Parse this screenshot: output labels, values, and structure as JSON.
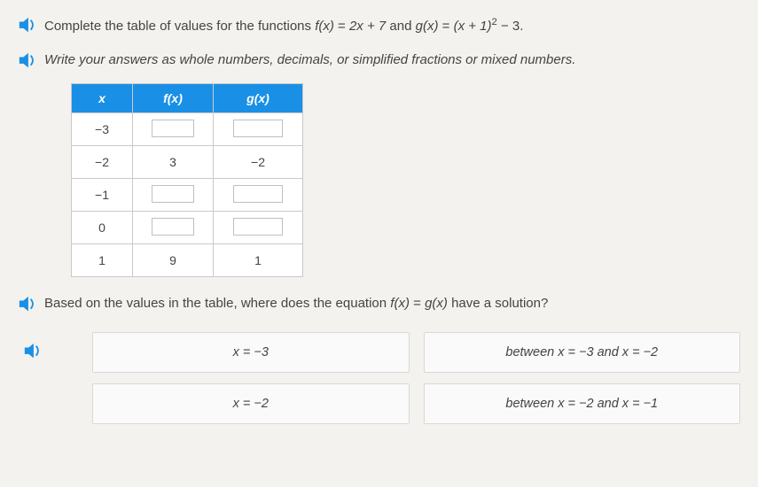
{
  "prompt1_prefix": "Complete the table of values for the functions ",
  "prompt1_mid": " and ",
  "prompt1_suffix": ".",
  "f_expr_lhs": "f(x)",
  "f_expr_rhs": "2x + 7",
  "g_expr_lhs": "g(x)",
  "g_expr_rhs_base": "(x + 1)",
  "g_expr_rhs_exp": "2",
  "g_expr_rhs_tail": " − 3",
  "prompt2": "Write your answers as whole numbers, decimals, or simplified fractions or mixed numbers.",
  "table": {
    "headers": {
      "x": "x",
      "f": "f(x)",
      "g": "g(x)"
    },
    "rows": [
      {
        "x": "−3",
        "f": "",
        "g": ""
      },
      {
        "x": "−2",
        "f": "3",
        "g": "−2"
      },
      {
        "x": "−1",
        "f": "",
        "g": ""
      },
      {
        "x": "0",
        "f": "",
        "g": ""
      },
      {
        "x": "1",
        "f": "9",
        "g": "1"
      }
    ]
  },
  "prompt3_prefix": "Based on the values in the table, where does the equation ",
  "prompt3_eq_l": "f(x)",
  "prompt3_eq_m": " = ",
  "prompt3_eq_r": "g(x)",
  "prompt3_suffix": " have a solution?",
  "options": {
    "a": "x = −3",
    "b": "between x = −3 and x = −2",
    "c": "x = −2",
    "d": "between x = −2 and x = −1"
  },
  "icons": {
    "speaker": "speaker-icon"
  }
}
